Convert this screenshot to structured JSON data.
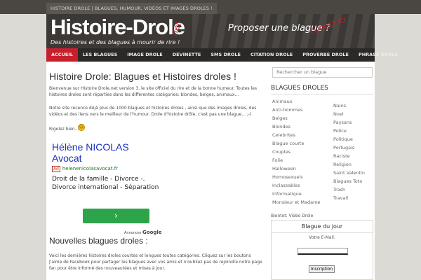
{
  "topbar": {
    "tagline": "HISTOIRE DROLE | BLAGUES, HUMOUR, VIDEOS ET IMAGES DROLES !"
  },
  "header": {
    "logo": "Histoire-Drole",
    "logo_suffix": "net",
    "subtitle": "Des histoires et des blagues à mourir de rire !",
    "propose": "Proposer une blague ?",
    "propose_badge": "CLIQUEZ ICI",
    "colors": {
      "accent": "#c81f2d",
      "header_bg": "#3b3835",
      "nav_bg": "#2b2927"
    }
  },
  "nav": {
    "items": [
      {
        "label": "ACCUEIL",
        "active": true
      },
      {
        "label": "LES BLAGUES"
      },
      {
        "label": "IMAGE DROLE"
      },
      {
        "label": "DEVINETTE"
      },
      {
        "label": "SMS DROLE"
      },
      {
        "label": "CITATION DROLE"
      },
      {
        "label": "PROVERBE DROLE"
      },
      {
        "label": "PHRASE DROLE"
      }
    ]
  },
  "main": {
    "title": "Histoire Drole: Blagues et Histoires droles !",
    "intro": "Bienvenue sur Histoire Drole.net version 3, le site officiel du rire et de la bonne humeur. Toutes les histoires droles sont réparties dans les différentes catégories: blondes, belges, animaux...",
    "intro2": "Notre site recence déjà plus de 1000 blagues et histoires droles , ainsi que des images droles, des vidéos et des liens vers le meilleur de l'humour. Drole d'histoire drôle, c'est pas une blague... ;-)",
    "rigolez": "Rigolez bien...",
    "smiley": "smiley-icon",
    "ad": {
      "title_line1": "Hélène NICOLAS",
      "title_line2": "Avocat",
      "badge": "Ad",
      "url": "helenenicolasavocat.fr",
      "text_line1": "Droit de la famille - Divorce -.",
      "text_line2": "Divorce international - Séparation",
      "button": "›",
      "adsby": "Annonces",
      "adsby_brand": "Google"
    },
    "section_title": "Nouvelles blagues droles :",
    "intro3": "Voici les dernières histoires droles courtes et longues toutes catégories. Cliquez sur les boutons J'aime de Facebook pour partager les blagues avec vos amis et n'oubliez pas de rejoindre notre page fan pour être informé des nouveautées et mises à jour."
  },
  "sidebar": {
    "search_placeholder": "Rechercher un blague",
    "categories_title": "BLAGUES DROLES",
    "categories_left": [
      "Animaux",
      "Anti-hommes",
      "Belges",
      "Blondes",
      "Celebrites",
      "Blague courte",
      "Couples",
      "Folie",
      "Halloween",
      "Homosexuels",
      "Inclassables",
      "Informatique",
      "Monsieur et Madame"
    ],
    "categories_right": [
      "Nains",
      "Noel",
      "Paysans",
      "Police",
      "Politique",
      "Portugais",
      "Raciste",
      "Religion",
      "Saint Valentin",
      "Blagues Toto",
      "Trash",
      "Travail"
    ],
    "bientot": "Bientot: Video Drole",
    "box_title": "Blague du jour",
    "email_label": "Votre E-Mail:",
    "subscribe": "Inscription"
  }
}
